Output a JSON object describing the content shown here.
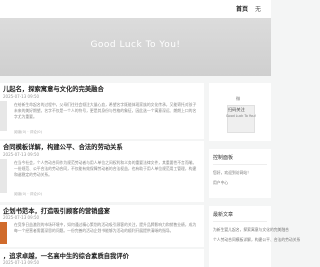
{
  "nav": {
    "items": [
      "首页",
      "无"
    ]
  },
  "hero": {
    "title": "Good Luck To You!"
  },
  "posts": [
    {
      "title": "儿起名，探索寓意与文化的完美融合",
      "meta": "2025-07-13 09:50",
      "excerpt": "在给新生命起名的过程中，父母们往往会倾注大量心血，希望名字既能体现家族的文化传承，又能寄托对孩子未来的美好期望。名字不仅是一个人的符号，更是其身份与性格的象征，因此选一个寓意深远、朗朗上口的名字尤为重要。",
      "footer": "阅读(0) · 评论(0)"
    },
    {
      "title": "合同模板详解，构建公平、合法的劳动关系",
      "meta": "2025-07-13 09:50",
      "excerpt": "在当今社会，个人劳动合同作为规范劳动者与用人单位之间权利和义务的重要法律文件，其重要性不言而喻。一份规范、公平合法的劳动合同，不仅能有效保障劳动者的合法权益，也有助于用人单位规范用工管理，构建和谐稳定的劳动关系。",
      "footer": "阅读(0) · 评论(0)"
    },
    {
      "title": "企划书范本，打造吸引顾客的营销盛宴",
      "meta": "2025-07-13 09:50",
      "excerpt": "在竞争日益激烈的市场环境中，如何通过精心策划的活动吸引顾客的关注，提升品牌影响力和销售业绩，成为每一个经营者需要深思的问题。一份完善的活动企划书能够为活动的顺利开展提供清晰的指导。",
      "footer": "阅读(0) · 评论(0)"
    },
    {
      "title": "，追求卓越，一名高中生的综合素质自我评价",
      "meta": "2025-07-13 09:50",
      "excerpt": "",
      "footer": ""
    }
  ],
  "sidebar": {
    "qr_label": "微",
    "qr_title": "扫码关注",
    "slogan": "Good Luck To You!",
    "control_title": "控制面板",
    "control_links": [
      "您好，欢迎到访网站！",
      "用户中心"
    ],
    "recent_title": "最新文章",
    "recent_items": [
      "为新生婴儿起名，探索寓意与文化的完美融合",
      "个人劳动合同模板详解，构建公平、合法的劳动关系"
    ]
  }
}
